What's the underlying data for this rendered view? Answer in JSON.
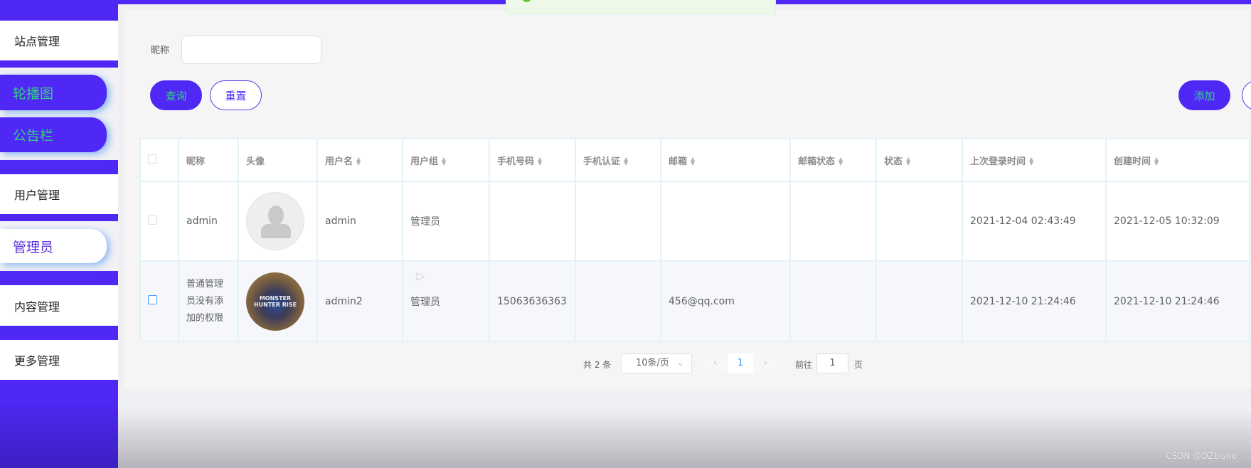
{
  "sidebar": {
    "items": [
      {
        "label": "站点管理"
      },
      {
        "label": "轮播图"
      },
      {
        "label": "公告栏"
      },
      {
        "label": "用户管理"
      },
      {
        "label": "管理员"
      },
      {
        "label": "内容管理"
      },
      {
        "label": "更多管理"
      }
    ]
  },
  "search": {
    "nickname_label": "昵称",
    "nickname_value": "",
    "query": "查询",
    "reset": "重置",
    "add": "添加"
  },
  "table": {
    "headers": [
      "昵称",
      "头像",
      "用户名",
      "用户组",
      "手机号码",
      "手机认证",
      "邮箱",
      "邮箱状态",
      "状态",
      "上次登录时间",
      "创建时间"
    ],
    "rows": [
      {
        "nickname": "admin",
        "username": "admin",
        "group": "管理员",
        "phone": "",
        "phone_verified": "",
        "email": "",
        "email_status": "",
        "status": "",
        "last_login": "2021-12-04 02:43:49",
        "created": "2021-12-05 10:32:09"
      },
      {
        "nickname": "普通管理员没有添加的权限",
        "avatar_text": "MONSTER HUNTER RISE",
        "username": "admin2",
        "group": "管理员",
        "phone": "15063636363",
        "phone_verified": "",
        "email": "456@qq.com",
        "email_status": "",
        "status": "",
        "last_login": "2021-12-10 21:24:46",
        "created": "2021-12-10 21:24:46"
      }
    ]
  },
  "pagination": {
    "total": "共 2 条",
    "page_size": "10条/页",
    "current": "1",
    "goto_label": "前往",
    "goto_value": "1",
    "page_suffix": "页",
    "prev": "‹",
    "next": "›"
  },
  "watermark": "CSDN @DZbishe",
  "colors": {
    "primary": "#4f28f6",
    "accent_text": "#34d27c"
  }
}
